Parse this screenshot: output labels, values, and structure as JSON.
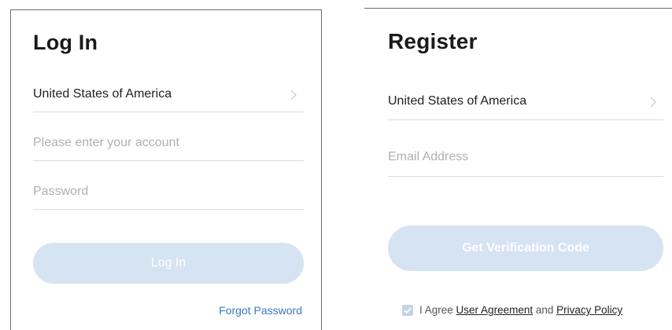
{
  "login": {
    "title": "Log In",
    "country": "United States of America",
    "account_placeholder": "Please enter your account",
    "password_placeholder": "Password",
    "login_button": "Log In",
    "forgot_password": "Forgot Password"
  },
  "register": {
    "title": "Register",
    "country": "United States of America",
    "email_placeholder": "Email Address",
    "verify_button": "Get Verification Code",
    "agree_prefix": "I Agree",
    "user_agreement": "User Agreement",
    "agree_and": "and",
    "privacy_policy": "Privacy Policy",
    "agreement_checked": true
  },
  "colors": {
    "button_disabled_bg": "#d6e3f3",
    "link": "#3d79c4",
    "divider": "#dcdcdc"
  },
  "icons": {
    "country_chevron": "chevron-right-icon",
    "agree_check": "check-icon"
  }
}
